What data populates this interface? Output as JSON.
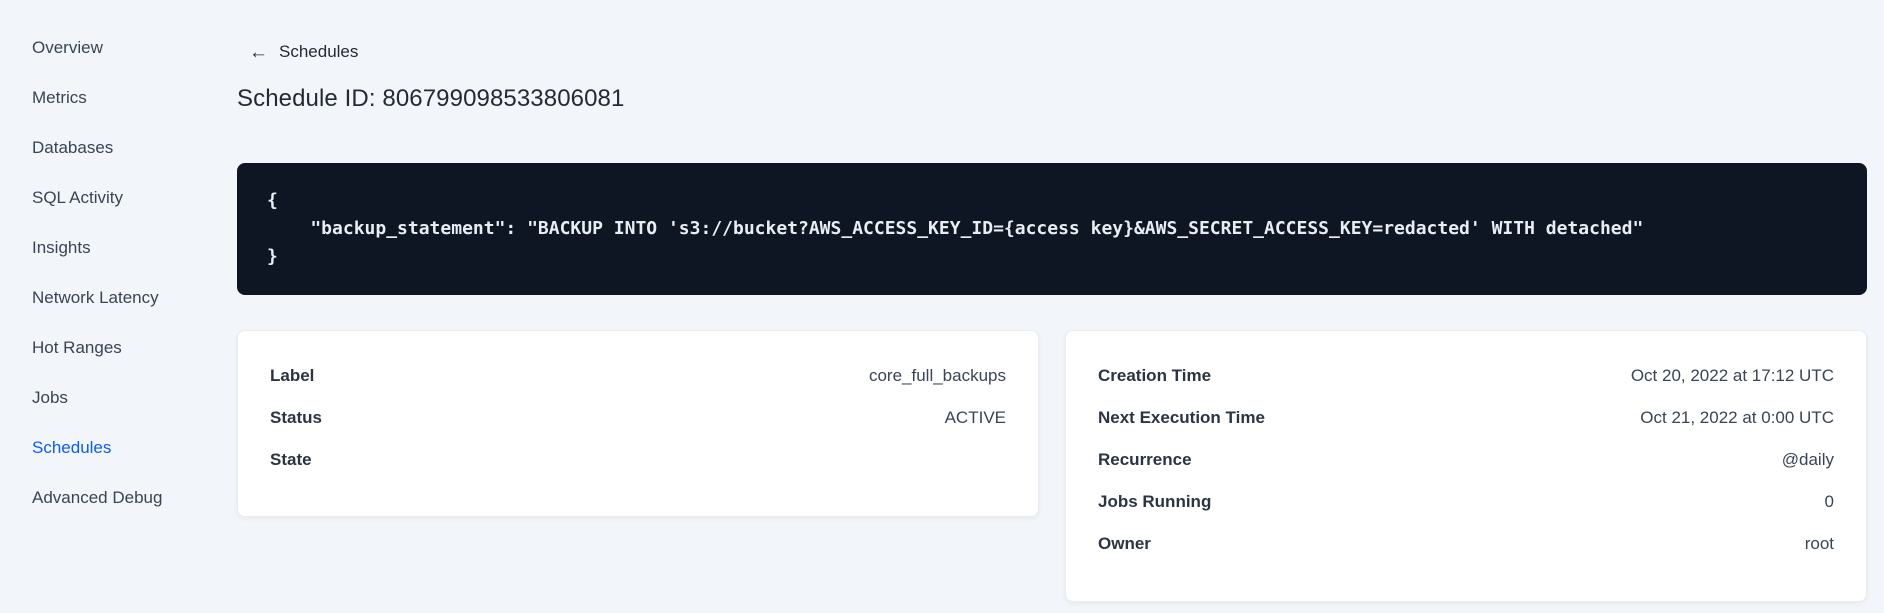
{
  "sidebar": {
    "items": [
      {
        "label": "Overview"
      },
      {
        "label": "Metrics"
      },
      {
        "label": "Databases"
      },
      {
        "label": "SQL Activity"
      },
      {
        "label": "Insights"
      },
      {
        "label": "Network Latency"
      },
      {
        "label": "Hot Ranges"
      },
      {
        "label": "Jobs"
      },
      {
        "label": "Schedules",
        "active": true
      },
      {
        "label": "Advanced Debug"
      }
    ]
  },
  "header": {
    "back_icon": "←",
    "back_label": "Schedules",
    "title": "Schedule ID: 806799098533806081"
  },
  "code_block": {
    "lines": [
      "{",
      "    \"backup_statement\": \"BACKUP INTO 's3://bucket?AWS_ACCESS_KEY_ID={access key}&AWS_SECRET_ACCESS_KEY=redacted' WITH detached\"",
      "}"
    ]
  },
  "detail_cards": {
    "left": {
      "rows": [
        {
          "label": "Label",
          "value": "core_full_backups"
        },
        {
          "label": "Status",
          "value": "ACTIVE"
        },
        {
          "label": "State",
          "value": ""
        }
      ]
    },
    "right": {
      "rows": [
        {
          "label": "Creation Time",
          "value": "Oct 20, 2022 at 17:12 UTC"
        },
        {
          "label": "Next Execution Time",
          "value": "Oct 21, 2022 at 0:00 UTC"
        },
        {
          "label": "Recurrence",
          "value": "@daily"
        },
        {
          "label": "Jobs Running",
          "value": "0"
        },
        {
          "label": "Owner",
          "value": "root"
        }
      ]
    }
  },
  "colors": {
    "page_background": "#F2F5F9",
    "active_link_blue": "#0B5CF0",
    "sidebar_text": "#394455",
    "heading_text": "#242A35",
    "code_background": "#0E1523",
    "code_text": "#E9EDF3",
    "card_background": "#FFFFFF",
    "card_border": "#E7ECF2"
  }
}
